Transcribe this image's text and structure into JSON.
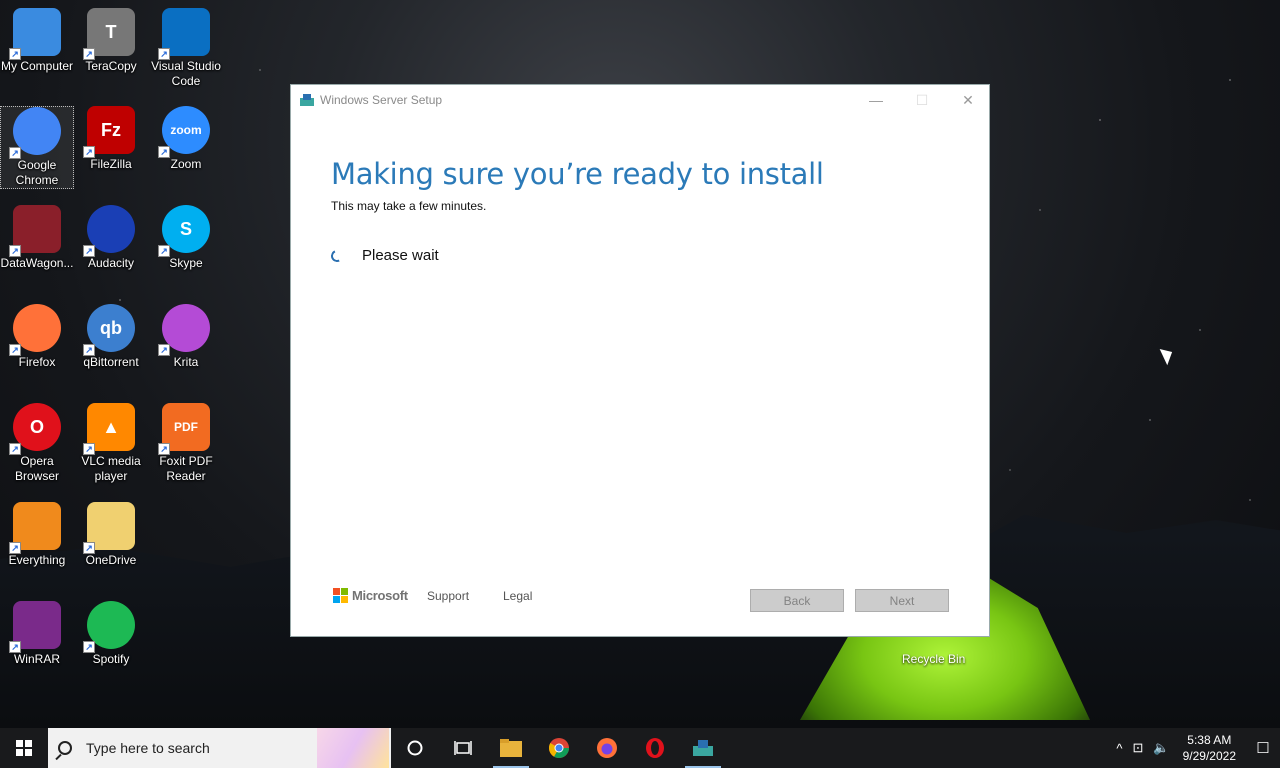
{
  "desktop": {
    "icons": [
      {
        "label": "My Computer",
        "icon": "computer-icon",
        "color": "#3a8be0"
      },
      {
        "label": "TeraCopy",
        "icon": "teracopy-icon",
        "color": "#777777"
      },
      {
        "label": "Visual Studio Code",
        "icon": "vscode-icon",
        "color": "#0a6fc2"
      },
      {
        "label": "Google Chrome",
        "icon": "chrome-icon",
        "color": "#4285f4"
      },
      {
        "label": "FileZilla",
        "icon": "filezilla-icon",
        "color": "#bf0000"
      },
      {
        "label": "Zoom",
        "icon": "zoom-icon",
        "color": "#2d8cff"
      },
      {
        "label": "DataWagon...",
        "icon": "datawagon-icon",
        "color": "#8a1f2a"
      },
      {
        "label": "Audacity",
        "icon": "audacity-icon",
        "color": "#1a3fb5"
      },
      {
        "label": "Skype",
        "icon": "skype-icon",
        "color": "#00aff0"
      },
      {
        "label": "Firefox",
        "icon": "firefox-icon",
        "color": "#ff7139"
      },
      {
        "label": "qBittorrent",
        "icon": "qbittorrent-icon",
        "color": "#3c7fcf"
      },
      {
        "label": "Krita",
        "icon": "krita-icon",
        "color": "#b44bd6"
      },
      {
        "label": "Opera Browser",
        "icon": "opera-icon",
        "color": "#e0111b"
      },
      {
        "label": "VLC media player",
        "icon": "vlc-icon",
        "color": "#ff8800"
      },
      {
        "label": "Foxit PDF Reader",
        "icon": "foxit-icon",
        "color": "#f26b21"
      },
      {
        "label": "Everything",
        "icon": "everything-icon",
        "color": "#f08a1c"
      },
      {
        "label": "OneDrive",
        "icon": "onedrive-icon",
        "color": "#f0d070"
      },
      {
        "label": "WinRAR",
        "icon": "winrar-icon",
        "color": "#7a2a8a"
      },
      {
        "label": "Spotify",
        "icon": "spotify-icon",
        "color": "#1db954"
      }
    ],
    "icon_glyphs": {
      "teracopy": "T",
      "filezilla": "Fz",
      "zoom": "zoom",
      "skype": "S",
      "qbittorrent": "qb",
      "foxit": "PDF",
      "opera": "O",
      "vlc": "▲"
    },
    "recycle_bin": "Recycle Bin"
  },
  "setup_window": {
    "title": "Windows Server Setup",
    "heading": "Making sure you’re ready to install",
    "subtitle": "This may take a few minutes.",
    "status": "Please wait",
    "footer": {
      "brand": "Microsoft",
      "links": [
        "Support",
        "Legal"
      ],
      "back_label": "Back",
      "next_label": "Next"
    },
    "controls": {
      "minimize": "—",
      "maximize": "☐",
      "close": "✕"
    },
    "accent_color": "#2b7ab8"
  },
  "taskbar": {
    "search_placeholder": "Type here to search",
    "time": "5:38 AM",
    "date": "9/29/2022",
    "tray_icons": [
      "^",
      "⊡",
      "🔈"
    ],
    "notification_glyph": "☐"
  }
}
